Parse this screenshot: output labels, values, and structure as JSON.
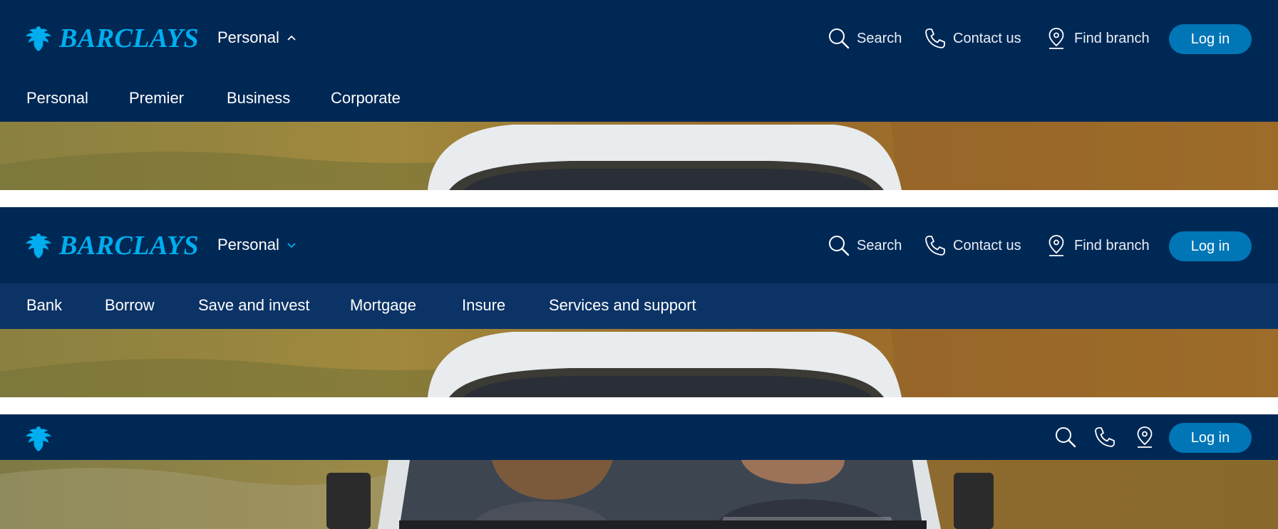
{
  "brand": {
    "name": "BARCLAYS",
    "color": "#00aeef"
  },
  "colors": {
    "header_bg": "#002855",
    "subnav_bg": "#0b3366",
    "login_bg": "#0076b6"
  },
  "header": {
    "persona_label": "Personal",
    "tools": {
      "search": {
        "label": "Search",
        "icon": "search-icon"
      },
      "contact": {
        "label": "Contact us",
        "icon": "phone-icon"
      },
      "branch": {
        "label": "Find branch",
        "icon": "location-pin-icon"
      }
    },
    "login_label": "Log in"
  },
  "variant1": {
    "persona_chevron": "chevron-up-icon",
    "segments": [
      "Personal",
      "Premier",
      "Business",
      "Corporate"
    ]
  },
  "variant2": {
    "persona_chevron": "chevron-down-icon",
    "menu": [
      "Bank",
      "Borrow",
      "Save and invest",
      "Mortgage",
      "Insure",
      "Services and support"
    ]
  }
}
